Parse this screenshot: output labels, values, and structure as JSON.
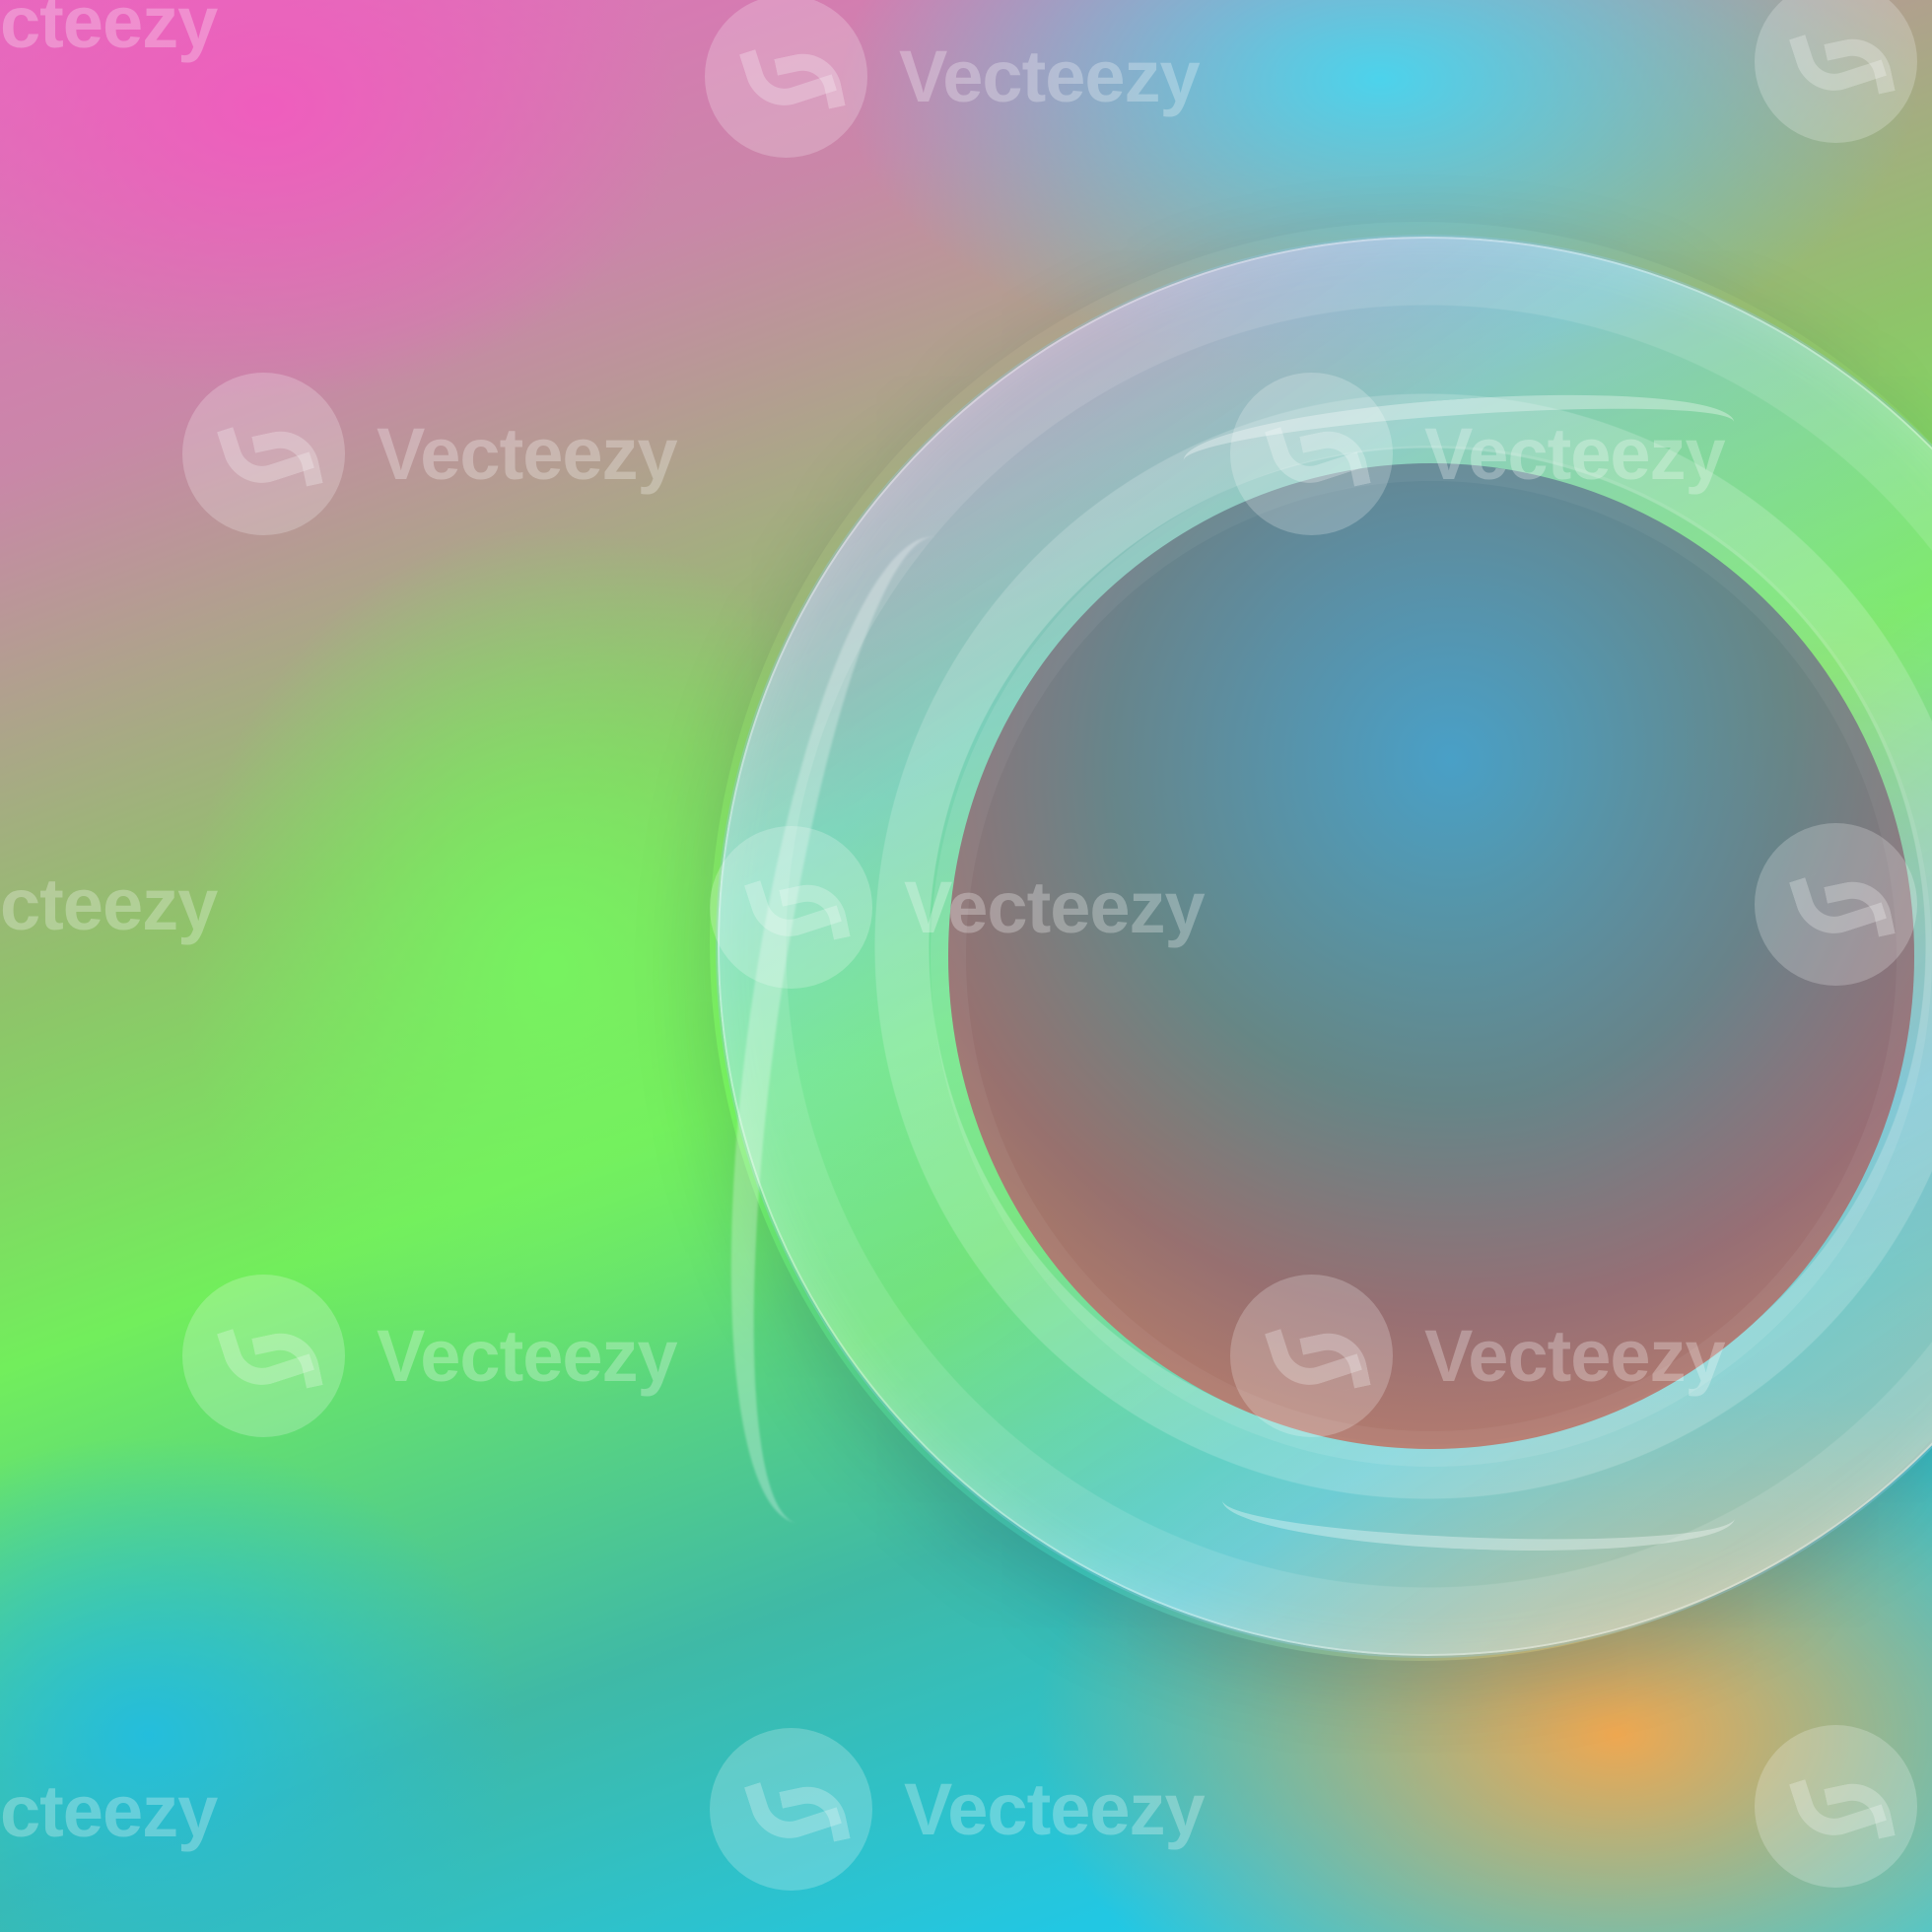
{
  "image": {
    "watermark_text": "Vecteezy",
    "partial_watermark_text": "cteezy",
    "colors": {
      "pink": "#e66bbf",
      "cyan": "#4ad7f0",
      "green": "#73ef5e",
      "orange": "#f2a84d",
      "ring_blue": "#78c9f0"
    }
  }
}
